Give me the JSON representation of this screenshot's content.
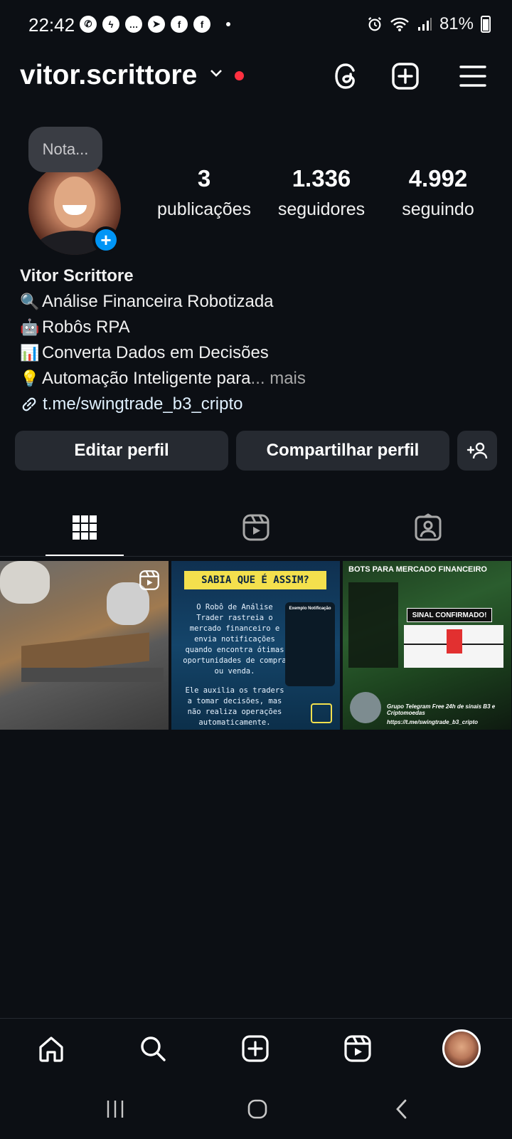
{
  "status_bar": {
    "time": "22:42",
    "battery": "81%",
    "app_icons": [
      "whatsapp-icon",
      "messenger-icon",
      "messages-icon",
      "telegram-icon",
      "facebook-icon",
      "facebook-icon"
    ]
  },
  "header": {
    "username": "vitor.scrittore",
    "actions": [
      "threads-icon",
      "create-icon",
      "menu-icon"
    ]
  },
  "profile": {
    "note_placeholder": "Nota...",
    "stats": [
      {
        "value": "3",
        "label": "publicações"
      },
      {
        "value": "1.336",
        "label": "seguidores"
      },
      {
        "value": "4.992",
        "label": "seguindo"
      }
    ],
    "name": "Vitor Scrittore",
    "bio": [
      {
        "emoji": "🔍",
        "text": "Análise Financeira Robotizada"
      },
      {
        "emoji": "🤖",
        "text": "Robôs RPA"
      },
      {
        "emoji": "📊",
        "text": "Converta Dados em Decisões"
      },
      {
        "emoji": "💡",
        "text": " Automação Inteligente para"
      }
    ],
    "more": "... mais",
    "link": "t.me/swingtrade_b3_cripto"
  },
  "buttons": {
    "edit": "Editar perfil",
    "share": "Compartilhar perfil"
  },
  "posts": {
    "post2": {
      "banner": "SABIA QUE É ASSIM?",
      "body": "O Robô de Análise Trader rastreia o mercado financeiro e envia notificações quando encontra ótimas oportunidades de compra ou venda.",
      "body2": "Ele auxilia os traders a tomar decisões, mas não realiza operações automaticamente.",
      "card_title": "Exemplo Notificação"
    },
    "post3": {
      "title": "BOTS PARA MERCADO FINANCEIRO",
      "signal": "SINAL CONFIRMADO!",
      "footer": "Grupo Telegram Free 24h de sinais B3 e Criptomoedas",
      "url": "https://t.me/swingtrade_b3_cripto"
    }
  },
  "colors": {
    "background": "#0c0f14",
    "button_bg": "#262a31",
    "accent_blue": "#0095f6",
    "notification_dot": "#ff3040",
    "link": "#e0f1ff"
  }
}
